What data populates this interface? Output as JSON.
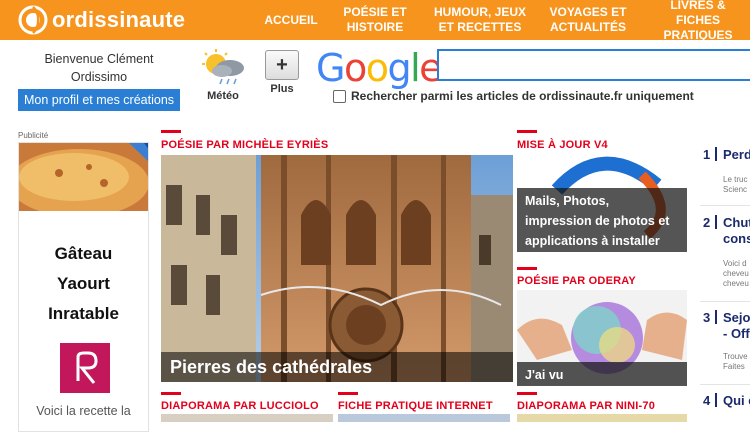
{
  "header": {
    "logo_text": "ordissinaute",
    "nav": [
      {
        "label": "ACCUEIL"
      },
      {
        "label": "POÉSIE ET\nHISTOIRE"
      },
      {
        "label": "HUMOUR, JEUX\nET RECETTES"
      },
      {
        "label": "VOYAGES ET\nACTUALITÉS"
      },
      {
        "label": "LIVRES &\nFICHES PRATIQUES"
      }
    ],
    "colors": {
      "bar": "#f7941d",
      "accent": "#e3001b",
      "link": "#2a7fd4"
    }
  },
  "user": {
    "welcome_line1": "Bienvenue Clément",
    "welcome_line2": "Ordissimo",
    "profile_button": "Mon profil et mes créations"
  },
  "tools": {
    "meteo_label": "Météo",
    "meteo_icon": "weather-icon",
    "plus_symbol": "+",
    "plus_label": "Plus"
  },
  "search": {
    "logo": "Google",
    "value": "",
    "checkbox_label": "Rechercher parmi les articles de ordissinaute.fr uniquement",
    "checked": false
  },
  "ad": {
    "label": "Publicité",
    "lines": [
      "Gâteau",
      "Yaourt",
      "Inratable"
    ],
    "bottom_text": "Voici la recette la"
  },
  "featured": {
    "category": "POÉSIE PAR MICHÈLE EYRIÈS",
    "title": "Pierres des cathédrales"
  },
  "side_articles": [
    {
      "category": "MISE À JOUR V4",
      "title": "Mails, Photos, impression de photos et applications à installer"
    },
    {
      "category": "POÉSIE PAR ODERAY",
      "title": "J'ai vu"
    }
  ],
  "bottom_categories": [
    {
      "label": "DIAPORAMA PAR LUCCIOLO"
    },
    {
      "label": "FICHE PRATIQUE INTERNET"
    },
    {
      "label": "DIAPORAMA PAR NINI-70"
    }
  ],
  "ranking": [
    {
      "num": "1",
      "title": "Perd",
      "sub": [
        "Le truc",
        "Scienc"
      ]
    },
    {
      "num": "2",
      "title": "Chut",
      "title2": "cons",
      "sub": [
        "Voici d",
        "cheveu",
        "cheveu"
      ]
    },
    {
      "num": "3",
      "title": "Sejo",
      "title2": "- Off",
      "sub": [
        "Trouve",
        "Faites"
      ]
    },
    {
      "num": "4",
      "title": "Qui e",
      "sub": []
    }
  ]
}
